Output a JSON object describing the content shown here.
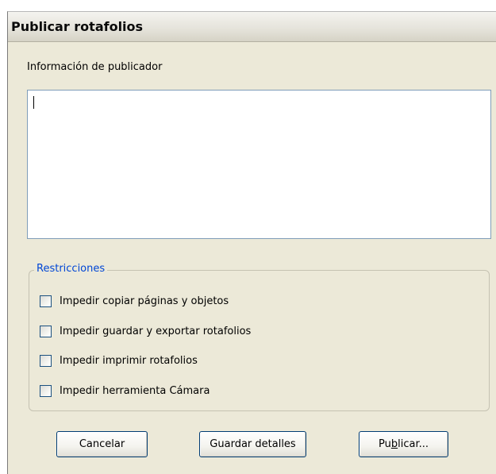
{
  "window": {
    "title": "Publicar rotafolios"
  },
  "publisher": {
    "label": "Información de publicador",
    "value": ""
  },
  "restrictions": {
    "legend": "Restricciones",
    "items": [
      {
        "label": "Impedir copiar páginas y objetos",
        "checked": false
      },
      {
        "label": "Impedir guardar y exportar rotafolios",
        "checked": false
      },
      {
        "label": "Impedir imprimir rotafolios",
        "checked": false
      },
      {
        "label": "Impedir herramienta Cámara",
        "checked": false
      }
    ]
  },
  "buttons": {
    "cancel": "Cancelar",
    "save": "Guardar detalles",
    "publish_pre": "Pu",
    "publish_mnemonic": "b",
    "publish_post": "licar..."
  },
  "colors": {
    "dialog_bg": "#ece9d8",
    "legend_text": "#0046d5",
    "field_border": "#7f9db9",
    "button_border": "#003c74"
  }
}
